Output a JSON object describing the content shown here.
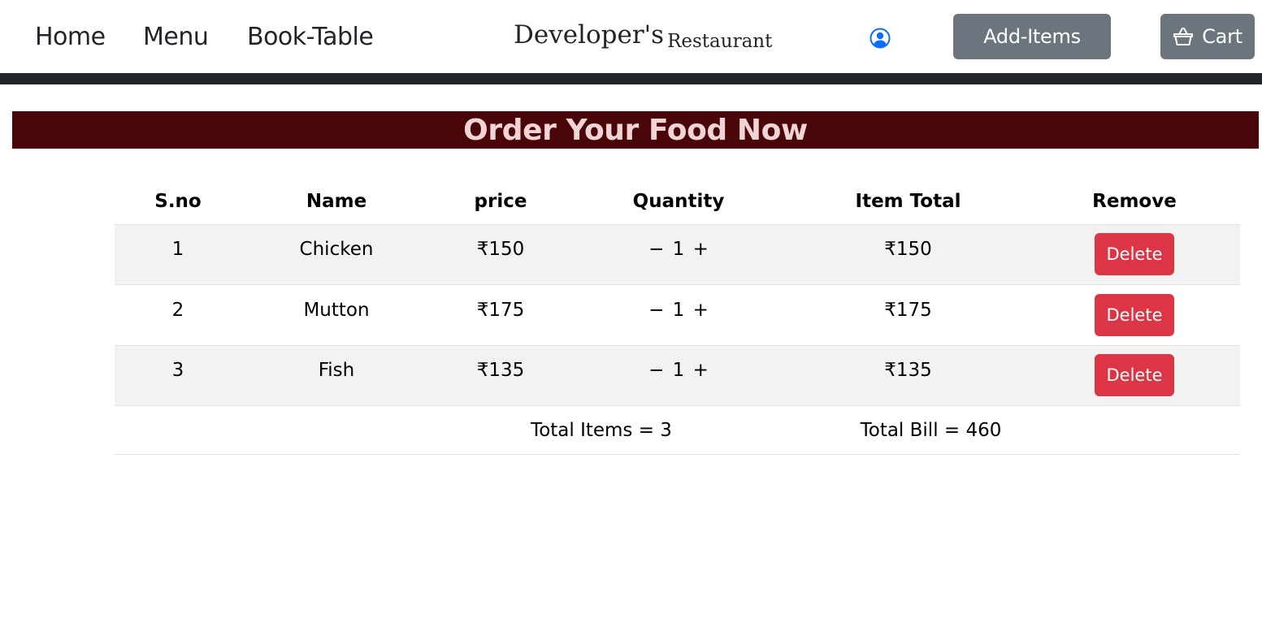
{
  "nav": {
    "links": [
      "Home",
      "Menu",
      "Book-Table"
    ],
    "brand_main": "Developer's",
    "brand_sub": "Restaurant",
    "add_items_label": "Add-Items",
    "cart_label": "Cart",
    "icons": {
      "user": "user-circle-icon",
      "cart": "basket-icon"
    }
  },
  "banner": {
    "title": "Order Your Food Now"
  },
  "table": {
    "headers": [
      "S.no",
      "Name",
      "price",
      "Quantity",
      "Item Total",
      "Remove"
    ],
    "rows": [
      {
        "sno": "1",
        "name": "Chicken",
        "price": "₹150",
        "qty_minus": "−",
        "qty": "1",
        "qty_plus": "+",
        "total": "₹150",
        "action": "Delete"
      },
      {
        "sno": "2",
        "name": "Mutton",
        "price": "₹175",
        "qty_minus": "−",
        "qty": "1",
        "qty_plus": "+",
        "total": "₹175",
        "action": "Delete"
      },
      {
        "sno": "3",
        "name": "Fish",
        "price": "₹135",
        "qty_minus": "−",
        "qty": "1",
        "qty_plus": "+",
        "total": "₹135",
        "action": "Delete"
      }
    ],
    "footer": {
      "total_items": "Total Items = 3",
      "total_bill": "Total Bill = 460"
    }
  },
  "colors": {
    "navbar_border": "#212529",
    "banner_bg": "#4a0508",
    "banner_text": "#f2d4d6",
    "gray_button": "#6c757d",
    "delete_button": "#dc3545",
    "user_icon": "#0d6efd"
  }
}
